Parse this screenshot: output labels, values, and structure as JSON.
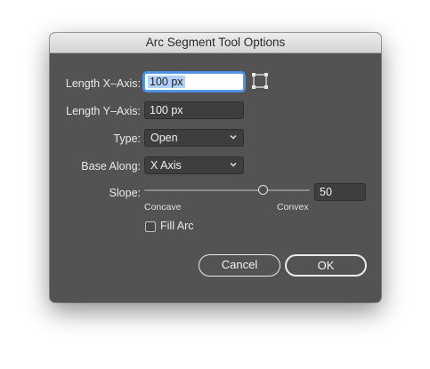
{
  "dialog": {
    "title": "Arc Segment Tool Options",
    "length_x": {
      "label": "Length X–Axis:",
      "value": "100 px"
    },
    "length_y": {
      "label": "Length Y–Axis:",
      "value": "100 px"
    },
    "type": {
      "label": "Type:",
      "selected": "Open"
    },
    "base_along": {
      "label": "Base Along:",
      "selected": "X Axis"
    },
    "slope": {
      "label": "Slope:",
      "value": "50",
      "fraction": 0.72,
      "min_label": "Concave",
      "max_label": "Convex"
    },
    "fill_arc": {
      "label": "Fill Arc",
      "checked": false
    },
    "buttons": {
      "cancel": "Cancel",
      "ok": "OK"
    },
    "icons": {
      "reference_point": "reference-point-icon",
      "dropdown": "chevron-down-icon"
    }
  },
  "colors": {
    "panel": "#535353",
    "field": "#3e3e3e",
    "focus_ring": "#4d90e6",
    "text": "#e8e8e8"
  }
}
